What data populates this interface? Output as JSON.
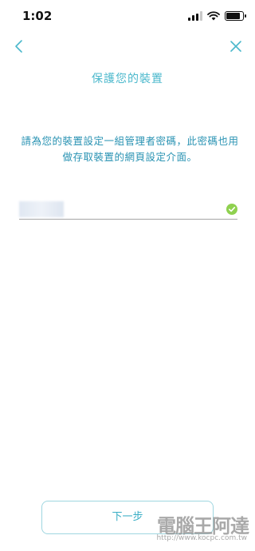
{
  "status_bar": {
    "time": "1:02",
    "signal_bars": 3,
    "signal_max": 4,
    "battery_level": 0.9
  },
  "nav": {
    "back_icon": "chevron-left-icon",
    "close_icon": "close-icon",
    "accent_color": "#4bb8cc"
  },
  "page": {
    "title": "保護您的裝置",
    "description": "請為您的裝置設定一組管理者密碼，此密碼也用做存取裝置的網頁設定介面。"
  },
  "password": {
    "valid": true,
    "valid_icon": "check-circle-icon",
    "valid_color": "#8fd14f"
  },
  "footer": {
    "next_label": "下一步"
  },
  "watermark": {
    "logo_text": "電腦王阿達",
    "url": "http://www.kocpc.com.tw"
  }
}
